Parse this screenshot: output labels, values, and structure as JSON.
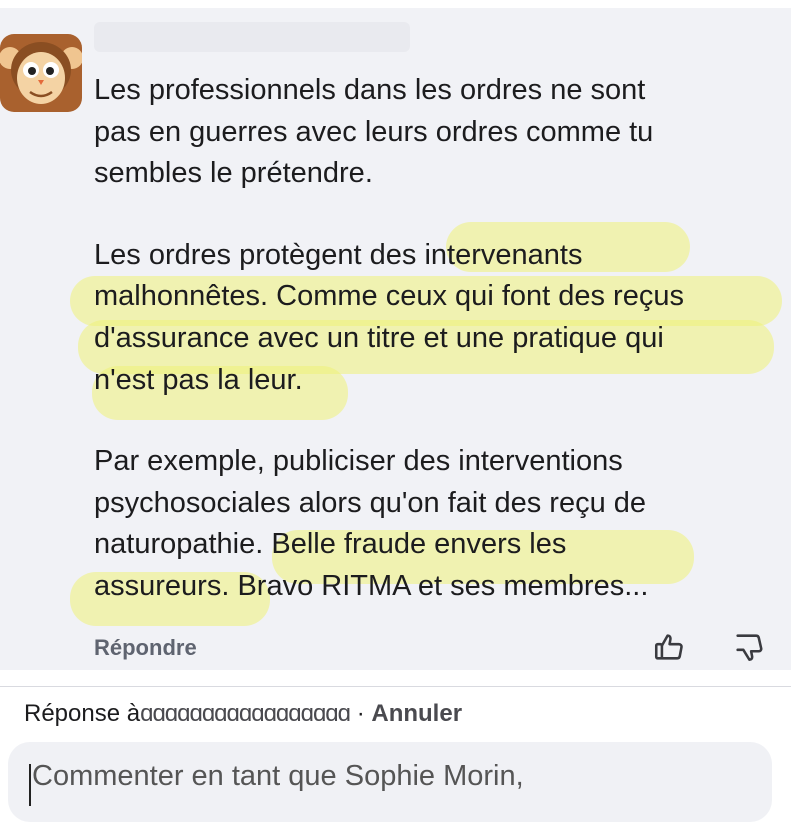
{
  "comment": {
    "paragraphs": [
      "Les professionnels dans les ordres ne sont\npas en guerres avec leurs ordres comme tu\nsembles le prétendre.",
      "Les ordres protègent des intervenants\nmalhonnêtes. Comme ceux qui font des reçus\nd'assurance avec un titre et une pratique qui\nn'est pas la leur.",
      "Par exemple, publiciser des interventions\npsychosociales alors qu'on fait des reçu de\nnaturopathie. Belle fraude envers les\nassureurs. Bravo RITMA et ses membres..."
    ],
    "reply_label": "Répondre",
    "highlight_color": "#eef278"
  },
  "reply_bar": {
    "prefix": "Réponse à",
    "name": "ɑɑɑɑɑɑɑɑɑɑɑɑɑɑɑɑɑ",
    "separator": "·",
    "cancel_label": "Annuler"
  },
  "composer": {
    "placeholder": "Commenter en tant que Sophie Morin,"
  },
  "icons": {
    "avatar": "monkey-avatar-icon",
    "like": "thumbs-up-icon",
    "dislike": "thumbs-down-icon"
  }
}
